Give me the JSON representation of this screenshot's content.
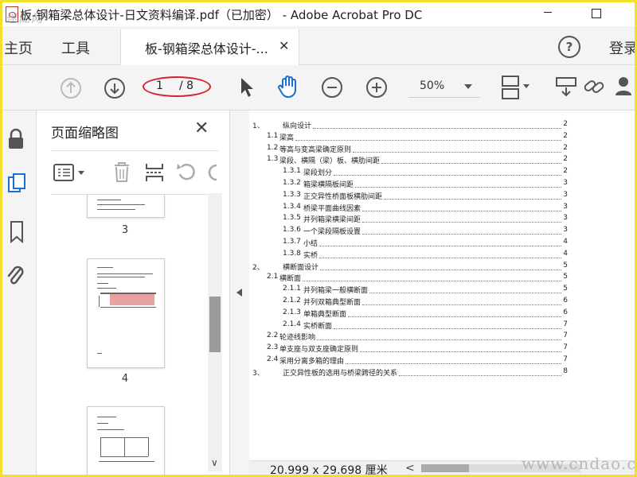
{
  "window": {
    "title": "板-钢箱梁总体设计-日文资料编译.pdf（已加密） - Adobe Acrobat Pro DC",
    "watermark_top": "迷糊网"
  },
  "tabs": {
    "home": "主页",
    "tools": "工具",
    "document": "板-钢箱梁总体设计-...",
    "signin": "登录"
  },
  "toolbar": {
    "page_current": "1",
    "page_total": "/ 8",
    "zoom": "50%"
  },
  "colors": {
    "frame": "#f2e02a",
    "highlight_oval": "#d8212a",
    "thumb_block": "#e9a2a2"
  },
  "thumbnail_panel": {
    "title": "页面缩略图",
    "pages": [
      "3",
      "4"
    ]
  },
  "toc": [
    {
      "num": "1、",
      "text": "纵向设计",
      "page": "2",
      "indent": "chapter"
    },
    {
      "num": "1.1",
      "text": "梁高",
      "page": "2",
      "indent": "l2"
    },
    {
      "num": "1.2",
      "text": "等高与变高梁确定原则",
      "page": "2",
      "indent": "l2"
    },
    {
      "num": "1.3",
      "text": "梁段、横隔（梁）板、横肋间距",
      "page": "2",
      "indent": "l2"
    },
    {
      "num": "1.3.1",
      "text": "梁段划分",
      "page": "2",
      "indent": "l3"
    },
    {
      "num": "1.3.2",
      "text": "箱梁横隔板间距",
      "page": "3",
      "indent": "l3"
    },
    {
      "num": "1.3.3",
      "text": "正交异性桥面板横肋间距",
      "page": "3",
      "indent": "l3"
    },
    {
      "num": "1.3.4",
      "text": "桥梁平面曲线因素",
      "page": "3",
      "indent": "l3"
    },
    {
      "num": "1.3.5",
      "text": "并列箱梁横梁间距",
      "page": "3",
      "indent": "l3"
    },
    {
      "num": "1.3.6",
      "text": "一个梁段隔板设置",
      "page": "3",
      "indent": "l3"
    },
    {
      "num": "1.3.7",
      "text": "小结",
      "page": "4",
      "indent": "l3"
    },
    {
      "num": "1.3.8",
      "text": "实桥",
      "page": "4",
      "indent": "l3"
    },
    {
      "num": "2、",
      "text": "横断面设计",
      "page": "5",
      "indent": "chapter"
    },
    {
      "num": "2.1",
      "text": "横断面",
      "page": "5",
      "indent": "l2"
    },
    {
      "num": "2.1.1",
      "text": "并列箱梁一般横断面",
      "page": "5",
      "indent": "l3"
    },
    {
      "num": "2.1.2",
      "text": "并列双箱典型断面",
      "page": "6",
      "indent": "l3"
    },
    {
      "num": "2.1.3",
      "text": "单箱典型断面",
      "page": "6",
      "indent": "l3"
    },
    {
      "num": "2.1.4",
      "text": "实桥断面",
      "page": "7",
      "indent": "l3"
    },
    {
      "num": "2.2",
      "text": "轮迹线影响",
      "page": "7",
      "indent": "l2"
    },
    {
      "num": "2.3",
      "text": "单支座与双支座确定原则",
      "page": "7",
      "indent": "l2"
    },
    {
      "num": "2.4",
      "text": "采用分离多箱的理由",
      "page": "7",
      "indent": "l2"
    },
    {
      "num": "3、",
      "text": "正交异性板的选用与桥梁跨径的关系",
      "page": "8",
      "indent": "chapter"
    }
  ],
  "status": {
    "page_size": "20.999 x 29.698 厘米",
    "scroll_left": "<",
    "watermark_bottom": "www.cndao.com"
  }
}
